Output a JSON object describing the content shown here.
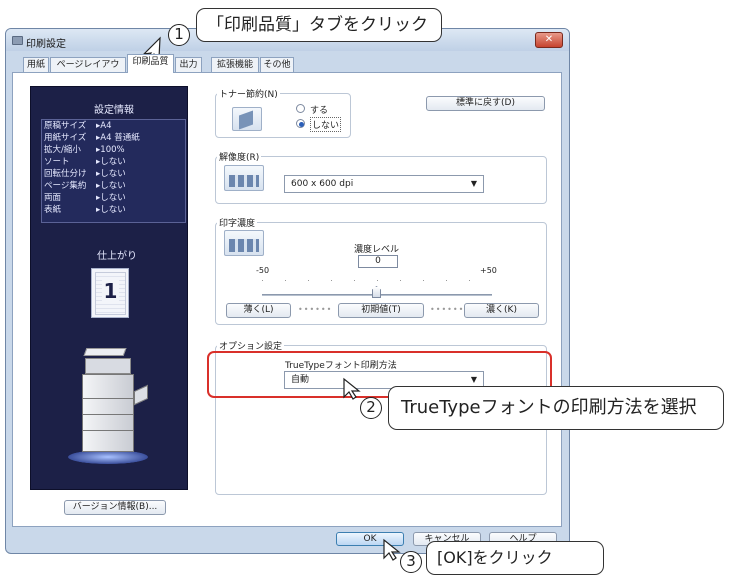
{
  "window": {
    "title": "印刷設定",
    "close": "✕"
  },
  "tabs": [
    {
      "label": "用紙"
    },
    {
      "label": "ページレイアウト"
    },
    {
      "label": "印刷品質"
    },
    {
      "label": "出力"
    },
    {
      "label": "拡張機能"
    },
    {
      "label": "その他"
    }
  ],
  "preview": {
    "heading": "設定情報",
    "rows": [
      {
        "k": "原稿サイズ",
        "v": "A4"
      },
      {
        "k": "用紙サイズ",
        "v": "A4 普通紙"
      },
      {
        "k": "拡大/縮小",
        "v": "100%"
      },
      {
        "k": "ソート",
        "v": "しない"
      },
      {
        "k": "回転仕分け",
        "v": "しない"
      },
      {
        "k": "ページ集約",
        "v": "しない"
      },
      {
        "k": "両面",
        "v": "しない"
      },
      {
        "k": "表紙",
        "v": "しない"
      }
    ],
    "finish_label": "仕上がり",
    "page_number": "1",
    "version_button": "バージョン情報(B)..."
  },
  "toner": {
    "label": "トナー節約(N)",
    "option_on": "する",
    "option_off": "しない",
    "selected": "しない"
  },
  "restore_button": "標準に戻す(D)",
  "resolution": {
    "label": "解像度(R)",
    "value": "600 x 600 dpi"
  },
  "density": {
    "label": "印字濃度",
    "level_label": "濃度レベル",
    "value": "0",
    "min": "-50",
    "max": "+50",
    "slider_fraction": 0.5,
    "lighter": "薄く(L)",
    "default": "初期値(T)",
    "darker": "濃く(K)"
  },
  "options": {
    "label": "オプション設定",
    "truetype_label": "TrueTypeフォント印刷方法",
    "truetype_value": "自動"
  },
  "footer": {
    "ok": "OK",
    "cancel": "キャンセル",
    "help": "ヘルプ"
  },
  "callouts": {
    "step1_num": "1",
    "step1": "「印刷品質」タブをクリック",
    "step2_num": "2",
    "step2": "TrueTypeフォントの印刷方法を選択",
    "step3_num": "3",
    "step3": "[OK]をクリック"
  },
  "colors": {
    "highlight": "#d9302a",
    "panel": "#1c2047",
    "window": "#c9d8ea"
  }
}
